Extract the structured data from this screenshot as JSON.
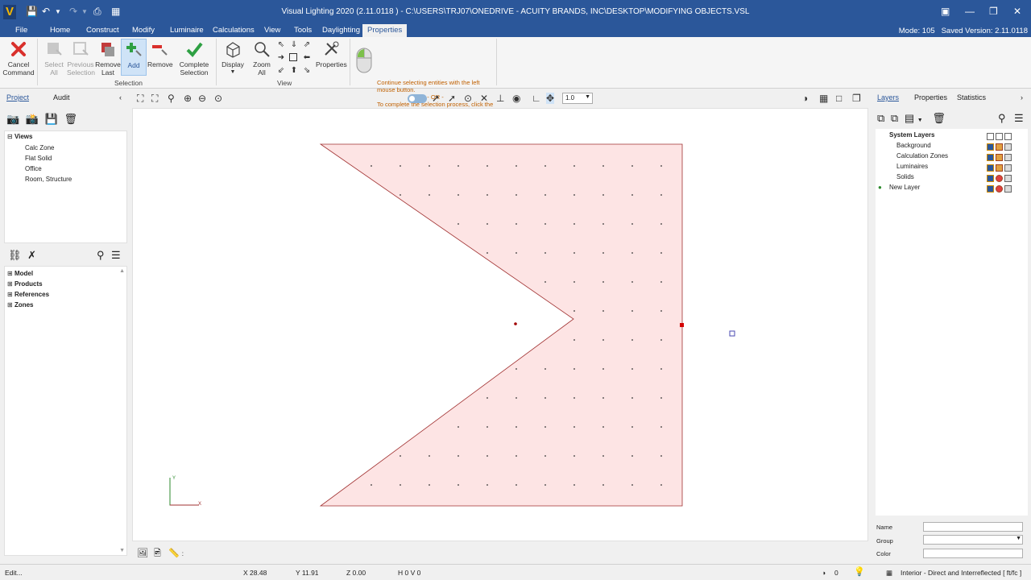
{
  "titlebar": {
    "logo": "V",
    "title": "Visual Lighting 2020 (2.11.0118 ) - C:\\USERS\\TRJ07\\ONEDRIVE - ACUITY BRANDS, INC\\DESKTOP\\MODIFYING OBJECTS.VSL"
  },
  "menu": {
    "items": [
      "File",
      "Home",
      "Construct",
      "Modify",
      "Luminaire",
      "Calculations",
      "View",
      "Tools",
      "Daylighting",
      "Properties"
    ],
    "mode": "Mode: 105",
    "saved_version": "Saved Version: 2.11.0118"
  },
  "ribbon": {
    "cancel": "Cancel\nCommand",
    "select_all": "Select\nAll",
    "previous_selection": "Previous\nSelection",
    "remove_last": "Remove\nLast",
    "add": "Add",
    "remove": "Remove",
    "complete_selection": "Complete\nSelection",
    "selection_group": "Selection",
    "display": "Display",
    "zoom_all": "Zoom\nAll",
    "properties": "Properties",
    "view_group": "View",
    "msg_line1": "Continue selecting entities with the left mouse button.",
    "msg_or": "- OR -",
    "msg_line2": "To complete the selection process, click the right mouse button."
  },
  "left_panel": {
    "tabs": [
      "Project",
      "Audit"
    ],
    "views_root": "Views",
    "views": [
      "Calc Zone",
      "Flat Solid",
      "Office",
      "Room, Structure"
    ],
    "tree": [
      "Model",
      "Products",
      "References",
      "Zones"
    ]
  },
  "toolbar": {
    "zoom_value": "1.0"
  },
  "right_panel": {
    "tabs": [
      "Layers",
      "Properties",
      "Statistics"
    ],
    "system_layers": "System Layers",
    "layers": [
      "Background",
      "Calculation Zones",
      "Luminaires",
      "Solids"
    ],
    "new_layer": "New Layer",
    "name_label": "Name",
    "group_label": "Group",
    "color_label": "Color"
  },
  "axes": {
    "y": "Y",
    "x": "X"
  },
  "status": {
    "left": "Edit...",
    "x": "X  28.48",
    "y": "Y  11.91",
    "z": "Z  0.00",
    "hv": "H 0  V 0",
    "count": "0",
    "calc_mode": "Interior - Direct and Interreflected [ ft/fc ]"
  },
  "colors": {
    "accent": "#2b579a",
    "shape_fill": "#fde4e4",
    "shape_stroke": "#a03030",
    "selection_point": "#d40000"
  }
}
